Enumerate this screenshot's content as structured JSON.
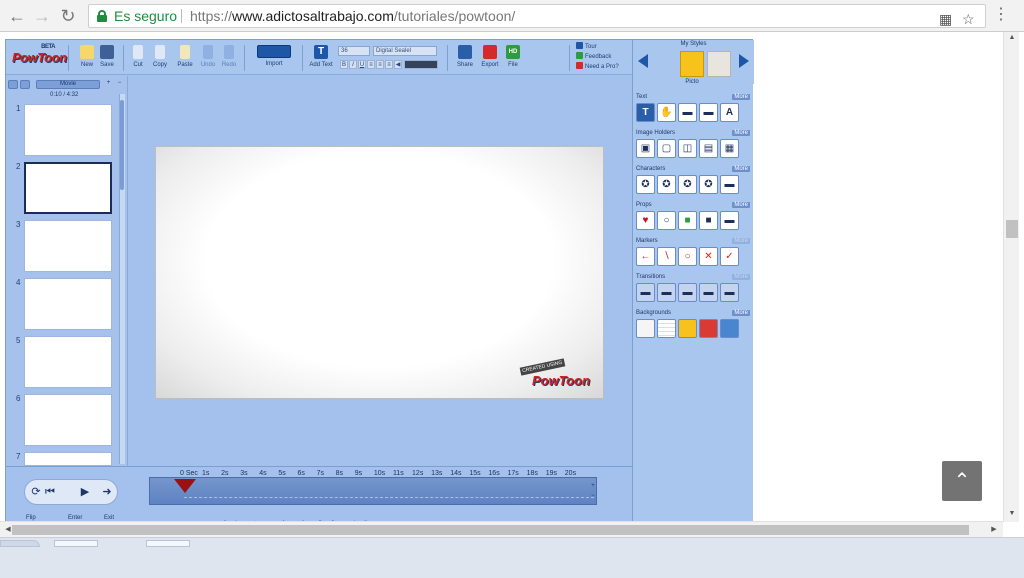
{
  "browser": {
    "secure_label": "Es seguro",
    "url_scheme": "https://",
    "url_host": "www.adictosaltrabajo.com",
    "url_path": "/tutoriales/powtoon/",
    "back_icon": "back-arrow-icon",
    "forward_icon": "forward-arrow-icon",
    "reload_icon": "reload-icon",
    "lock_icon": "lock-icon",
    "star_icon": "bookmark-star-icon"
  },
  "app": {
    "logo": "PowToon",
    "logo_tag": "BETA",
    "toolbar": {
      "new": "New",
      "save": "Save",
      "cut": "Cut",
      "copy": "Copy",
      "paste": "Paste",
      "undo": "Undo",
      "redo": "Redo",
      "import": "Import",
      "add_text": "Add Text",
      "font_size": "36",
      "font_name": "Digital Sealel",
      "share": "Share",
      "export": "Export",
      "file": "File",
      "hd_badge": "HD",
      "tour": "Tour",
      "feedback": "Feedback",
      "need_pro": "Need a Pro?"
    },
    "slides_panel": {
      "tab_movie": "Movie",
      "time_counter": "0:10 / 4:32",
      "slide_numbers": [
        "1",
        "2",
        "3",
        "4",
        "5",
        "6",
        "7"
      ]
    },
    "watermark": {
      "created_using": "CREATED USING",
      "brand": "PowToon"
    },
    "timeline": {
      "ticks": [
        "0 Sec",
        "1s",
        "2s",
        "3s",
        "4s",
        "5s",
        "6s",
        "7s",
        "8s",
        "9s",
        "10s",
        "11s",
        "12s",
        "13s",
        "14s",
        "15s",
        "16s",
        "17s",
        "18s",
        "19s",
        "20s"
      ],
      "flip_label": "Flip",
      "enter_label": "Enter",
      "exit_label": "Exit"
    },
    "library": {
      "my_styles": "My Styles",
      "style_label": "Picto",
      "categories": [
        {
          "name": "Text",
          "more": "More"
        },
        {
          "name": "Image Holders",
          "more": "More"
        },
        {
          "name": "Characters",
          "more": "More"
        },
        {
          "name": "Props",
          "more": "More"
        },
        {
          "name": "Markers",
          "more": "More"
        },
        {
          "name": "Transitions",
          "more": "More"
        },
        {
          "name": "Backgrounds",
          "more": "More"
        }
      ]
    }
  },
  "colors": {
    "app_bg": "#a3c1ec",
    "brand_red": "#d4231b",
    "brand_navy": "#1b3b6b",
    "secure_green": "#1e8e3e",
    "accent_yellow": "#f7c21b"
  },
  "page": {
    "scroll_top_icon": "chevron-up-icon"
  }
}
